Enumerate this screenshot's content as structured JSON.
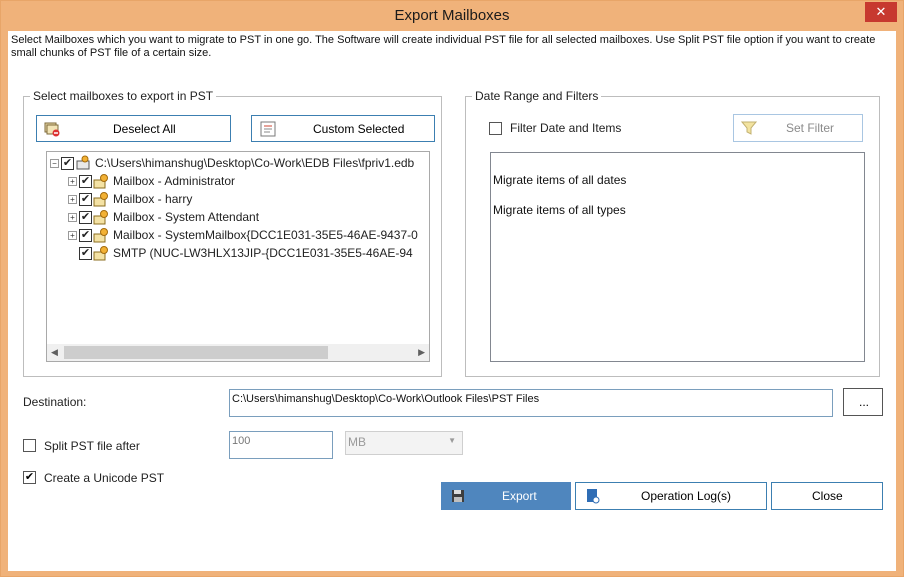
{
  "window": {
    "title": "Export Mailboxes",
    "close_glyph": "✕"
  },
  "description": "Select Mailboxes which you want to migrate to PST in one go. The Software will create individual PST file for all selected mailboxes. Use Split PST file option if you want to create small chunks of PST file of a certain size.",
  "mailbox_group": {
    "legend": "Select mailboxes to export in PST",
    "deselect_all_label": "Deselect All",
    "custom_selected_label": "Custom Selected",
    "tree": {
      "root": "C:\\Users\\himanshug\\Desktop\\Co-Work\\EDB Files\\fpriv1.edb",
      "items": [
        {
          "label": "Mailbox - Administrator",
          "checked": true,
          "expandable": true
        },
        {
          "label": "Mailbox - harry",
          "checked": true,
          "expandable": true
        },
        {
          "label": "Mailbox - System Attendant",
          "checked": true,
          "expandable": true
        },
        {
          "label": "Mailbox - SystemMailbox{DCC1E031-35E5-46AE-9437-0",
          "checked": true,
          "expandable": true
        },
        {
          "label": "SMTP (NUC-LW3HLX13JIP-{DCC1E031-35E5-46AE-94",
          "checked": true,
          "expandable": false
        }
      ]
    }
  },
  "filter_group": {
    "legend": "Date Range and Filters",
    "filter_checkbox_label": "Filter Date and Items",
    "set_filter_label": "Set Filter",
    "summary_lines": [
      "Migrate items of all dates",
      "Migrate items of all types"
    ]
  },
  "destination": {
    "label": "Destination:",
    "value": "C:\\Users\\himanshug\\Desktop\\Co-Work\\Outlook Files\\PST Files",
    "browse_label": "..."
  },
  "split": {
    "label": "Split PST file after",
    "checked": false,
    "size_value": "100",
    "unit": "MB"
  },
  "unicode": {
    "label": "Create a Unicode PST",
    "checked": true
  },
  "actions": {
    "export_label": "Export",
    "operation_log_label": "Operation Log(s)",
    "close_label": "Close"
  },
  "colors": {
    "frame": "#f0b27a",
    "export_button": "#4f86be",
    "button_border": "#3c7fb1"
  },
  "icons": {
    "deselect": "mailbox-remove-icon",
    "custom": "list-icon",
    "filter": "funnel-icon",
    "export": "floppy-disk-icon",
    "log": "document-gear-icon",
    "mailbox": "mailbox-user-icon"
  }
}
